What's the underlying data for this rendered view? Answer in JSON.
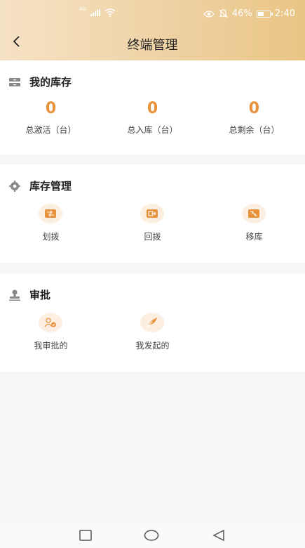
{
  "status_bar": {
    "network": "4G",
    "battery": "46%",
    "time": "2:40",
    "battery_level": 0.46
  },
  "header": {
    "title": "终端管理"
  },
  "inventory": {
    "title": "我的库存",
    "stats": [
      {
        "value": "0",
        "label": "总激活（台）"
      },
      {
        "value": "0",
        "label": "总入库（台）"
      },
      {
        "value": "0",
        "label": "总剩余（台）"
      }
    ]
  },
  "manage": {
    "title": "库存管理",
    "items": [
      {
        "label": "划拨",
        "icon": "transfer-icon"
      },
      {
        "label": "回拨",
        "icon": "recall-icon"
      },
      {
        "label": "移库",
        "icon": "move-stock-icon"
      }
    ]
  },
  "approval": {
    "title": "审批",
    "items": [
      {
        "label": "我审批的",
        "icon": "approver-icon"
      },
      {
        "label": "我发起的",
        "icon": "feather-icon"
      }
    ]
  },
  "colors": {
    "accent": "#e8923b",
    "header_start": "#f5e2c4",
    "header_end": "#e9c585"
  }
}
